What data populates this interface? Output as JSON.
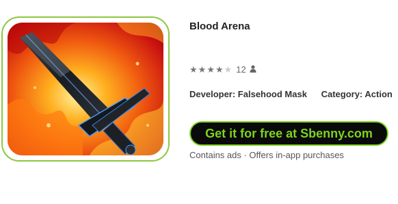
{
  "app": {
    "title": "Blood Arena",
    "icon": "flaming-sword-icon",
    "rating": 4,
    "rating_max": 5,
    "rating_count": "12",
    "developer_label": "Developer: Falsehood Mask",
    "category_label": "Category: Action",
    "download_button_label": "Get it for free at Sbenny.com",
    "notes": "Contains ads · Offers in-app purchases"
  },
  "colors": {
    "frame_border": "#8dc63f",
    "button_bg": "#0a0a0a",
    "button_text": "#7ed321",
    "star_filled": "#777777",
    "star_empty": "#cccccc"
  }
}
